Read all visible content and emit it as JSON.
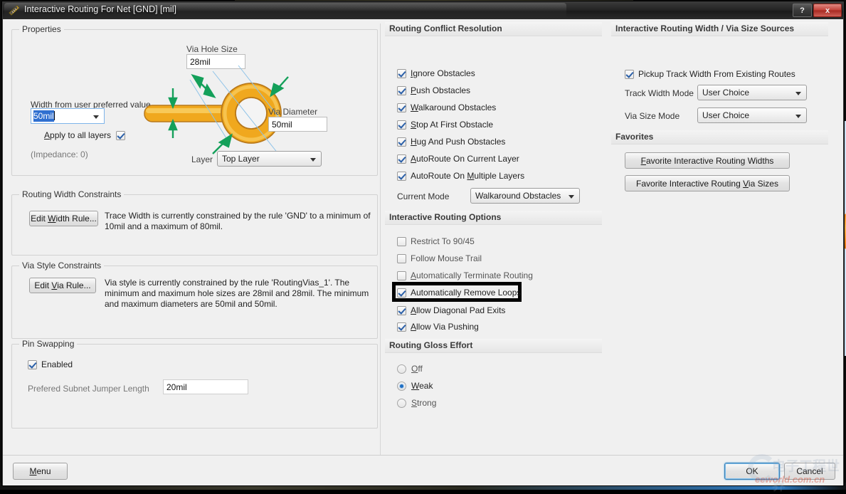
{
  "window": {
    "title": "Interactive Routing For Net [GND] [mil]",
    "icon": "ruler-triangle-icon",
    "help_label": "?",
    "close_label": "x"
  },
  "properties": {
    "group_title": "Properties",
    "width_label": "Width from user preferred value",
    "width_value": "50mil",
    "apply_all_layers_label": "Apply to all layers",
    "apply_all_layers_checked": true,
    "impedance_label": "(Impedance: 0)",
    "via_hole_size_label": "Via Hole Size",
    "via_hole_size_value": "28mil",
    "via_diameter_label": "Via Diameter",
    "via_diameter_value": "50mil",
    "layer_label": "Layer",
    "layer_value": "Top Layer"
  },
  "routing_width_constraints": {
    "group_title": "Routing Width Constraints",
    "edit_button": "Edit Width Rule...",
    "description": "Trace Width is currently constrained by the rule 'GND' to a minimum of 10mil and a maximum of 80mil."
  },
  "via_style_constraints": {
    "group_title": "Via Style Constraints",
    "edit_button": "Edit Via Rule...",
    "description": "Via style is currently constrained by the rule 'RoutingVias_1'. The minimum and maximum hole sizes are 28mil and 28mil. The minimum and maximum diameters are 50mil and 50mil."
  },
  "pin_swapping": {
    "group_title": "Pin Swapping",
    "enabled_label": "Enabled",
    "enabled_checked": true,
    "jumper_label": "Prefered Subnet Jumper Length",
    "jumper_value": "20mil"
  },
  "routing_conflict_resolution": {
    "header": "Routing Conflict Resolution",
    "options": [
      {
        "label": "Ignore Obstacles",
        "accel": "I",
        "checked": true
      },
      {
        "label": "Push Obstacles",
        "accel": "P",
        "checked": true
      },
      {
        "label": "Walkaround Obstacles",
        "accel": "W",
        "checked": true
      },
      {
        "label": "Stop At First Obstacle",
        "accel": "S",
        "checked": true
      },
      {
        "label": "Hug And Push Obstacles",
        "accel": "H",
        "checked": true
      },
      {
        "label": "AutoRoute On Current Layer",
        "accel": "A",
        "checked": true
      },
      {
        "label": "AutoRoute On Multiple Layers",
        "accel": "M",
        "checked": true
      }
    ],
    "current_mode_label": "Current Mode",
    "current_mode_value": "Walkaround Obstacles"
  },
  "interactive_routing_options": {
    "header": "Interactive Routing Options",
    "options": [
      {
        "label": "Restrict To 90/45",
        "accel": "",
        "checked": false
      },
      {
        "label": "Follow Mouse Trail",
        "accel": "",
        "checked": false
      },
      {
        "label": "Automatically Terminate Routing",
        "accel": "A",
        "checked": false
      },
      {
        "label": "Automatically Remove Loops",
        "accel": "",
        "checked": true,
        "highlighted": true
      },
      {
        "label": "Allow Diagonal Pad Exits",
        "accel": "A",
        "checked": true
      },
      {
        "label": "Allow Via Pushing",
        "accel": "A",
        "checked": true
      }
    ]
  },
  "routing_gloss_effort": {
    "header": "Routing Gloss Effort",
    "options": [
      {
        "label": "Off",
        "accel": "O",
        "selected": false
      },
      {
        "label": "Weak",
        "accel": "W",
        "selected": true
      },
      {
        "label": "Strong",
        "accel": "S",
        "selected": false
      }
    ]
  },
  "width_via_sources": {
    "header": "Interactive Routing Width / Via Size Sources",
    "pickup_label": "Pickup Track Width From Existing Routes",
    "pickup_checked": true,
    "track_width_mode_label": "Track Width Mode",
    "track_width_mode_value": "User Choice",
    "via_size_mode_label": "Via Size Mode",
    "via_size_mode_value": "User Choice"
  },
  "favorites": {
    "header": "Favorites",
    "widths_button": "Favorite Interactive Routing Widths",
    "via_sizes_button": "Favorite Interactive Routing Via Sizes"
  },
  "footer": {
    "menu_button": "Menu",
    "ok_button": "OK",
    "cancel_button": "Cancel"
  },
  "watermark": {
    "text": "eeworld.com.cn",
    "cjk": "电子工程世界"
  },
  "colors": {
    "accent": "#2f6fd0",
    "copper": "#f0a81e",
    "dimension_arrow": "#14a05a",
    "close_button": "#c4433a",
    "highlight_box": "#000000"
  }
}
